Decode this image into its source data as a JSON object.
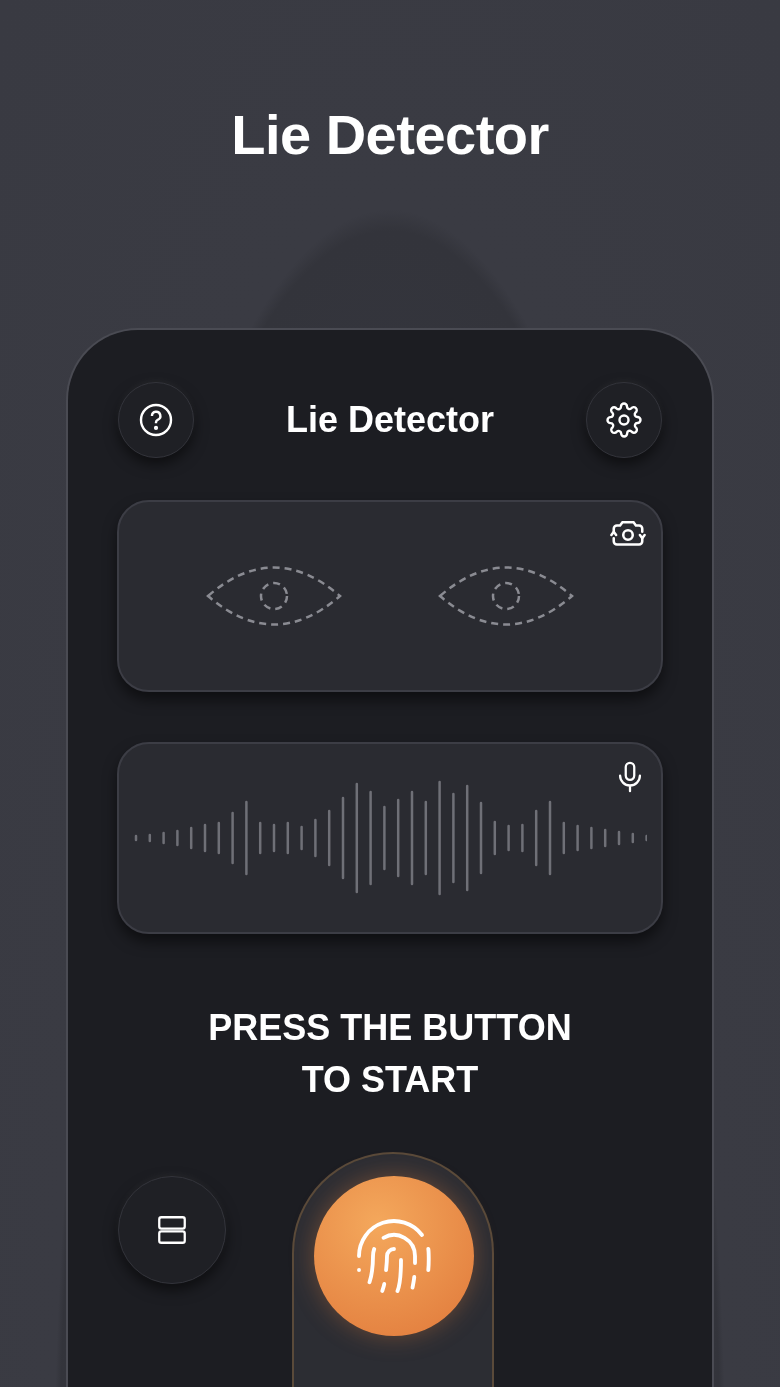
{
  "headline": "Lie Detector",
  "app": {
    "title": "Lie Detector",
    "prompt": [
      "PRESS THE BUTTON",
      "TO START"
    ]
  }
}
